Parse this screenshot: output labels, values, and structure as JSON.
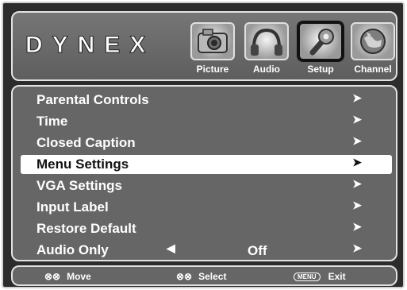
{
  "brand": "DYNEX",
  "tabs": [
    {
      "label": "Picture",
      "icon": "camera-icon"
    },
    {
      "label": "Audio",
      "icon": "headphones-icon"
    },
    {
      "label": "Setup",
      "icon": "wrench-icon"
    },
    {
      "label": "Channel",
      "icon": "globe-icon"
    }
  ],
  "menu": {
    "items": [
      {
        "label": "Parental Controls"
      },
      {
        "label": "Time"
      },
      {
        "label": "Closed Caption"
      },
      {
        "label": "Menu Settings"
      },
      {
        "label": "VGA Settings"
      },
      {
        "label": "Input Label"
      },
      {
        "label": "Restore Default"
      },
      {
        "label": "Audio Only",
        "value": "Off"
      }
    ],
    "arrow": "➤",
    "left_arrow": "◀"
  },
  "footer": {
    "move": {
      "icon": "up-down-icon",
      "glyphs": "⊗⊗",
      "label": "Move"
    },
    "select": {
      "icon": "left-right-icon",
      "glyphs": "⊗⊗",
      "label": "Select"
    },
    "exit": {
      "key": "MENU",
      "label": "Exit"
    }
  }
}
